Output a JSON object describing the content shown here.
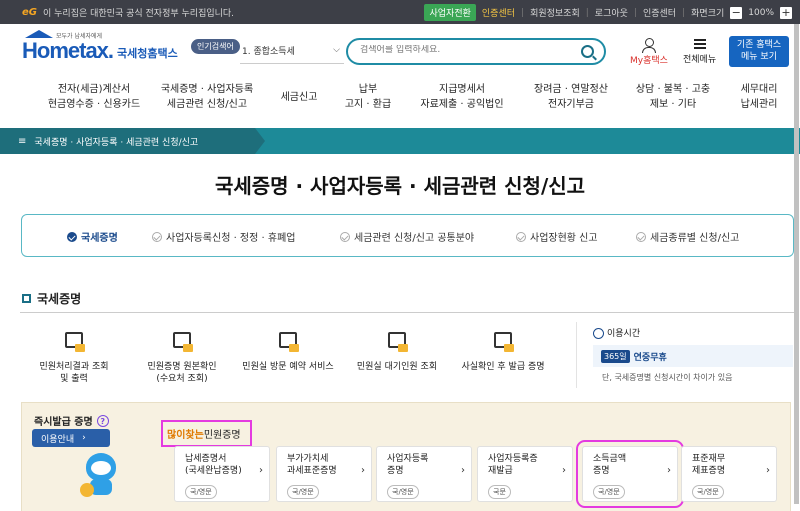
{
  "gov_bar": {
    "logo": "eG",
    "notice": "이 누리집은 대한민국 공식 전자정부 누리집입니다.",
    "items": [
      "사업자전환",
      "인증센터",
      "회원정보조회",
      "로그아웃",
      "인증센터",
      "화면크기"
    ],
    "zoom": "100%"
  },
  "header": {
    "logo_text": "Hometax.",
    "logo_name": "국세청홈택스",
    "logo_tag": "모두가 납세자에게",
    "popular_label": "인기검색어",
    "search_select": "1. 종합소득세",
    "search_placeholder": "검색어를 입력하세요.",
    "my_tax": "My홈택스",
    "all_menu": "전체메뉴",
    "basic_btn_line1": "기존 홈택스",
    "basic_btn_line2": "메뉴 보기"
  },
  "gnb": [
    {
      "l1": "전자(세금)계산서",
      "l2": "현금영수증 · 신용카드"
    },
    {
      "l1": "국세증명 · 사업자등록",
      "l2": "세금관련 신청/신고"
    },
    {
      "l1": "세금신고",
      "l2": ""
    },
    {
      "l1": "납부",
      "l2": "고지 · 환급"
    },
    {
      "l1": "지급명세서",
      "l2": "자료제출 · 공익법인"
    },
    {
      "l1": "장려금 · 연말정산",
      "l2": "전자기부금"
    },
    {
      "l1": "상담 · 불복 · 고충",
      "l2": "제보 · 기타"
    },
    {
      "l1": "세무대리",
      "l2": "납세관리"
    }
  ],
  "breadcrumb": "국세증명 · 사업자등록 · 세금관련 신청/신고",
  "page_title": "국세증명 · 사업자등록 · 세금관련 신청/신고",
  "tabs": [
    "국세증명",
    "사업자등록신청 · 정정 · 휴폐업",
    "세금관련 신청/신고 공통분야",
    "사업장현황 신고",
    "세금종류별 신청/신고"
  ],
  "section_title": "국세증명",
  "services": [
    {
      "l1": "민원처리결과 조회",
      "l2": "및 출력"
    },
    {
      "l1": "민원증명 원본확인",
      "l2": "(수요처 조회)"
    },
    {
      "l1": "민원실 방문 예약 서비스",
      "l2": ""
    },
    {
      "l1": "민원실 대기인원 조회",
      "l2": ""
    },
    {
      "l1": "사실확인 후 발급 증명",
      "l2": ""
    }
  ],
  "use_time": {
    "title": "이용시간",
    "badge": "365일",
    "value": "연중무휴",
    "note": "단, 국세증명별 신청시간이 차이가 있음"
  },
  "instant": {
    "title": "즉시발급 증명",
    "help": "?",
    "guide_btn": "이용안내",
    "popular_hot": "많이찾는",
    "popular_rest": " 민원증명",
    "cards": [
      {
        "l1": "납세증명서",
        "l2": "(국세완납증명)",
        "chip": "국/영문"
      },
      {
        "l1": "부가가치세",
        "l2": "과세표준증명",
        "chip": "국/영문"
      },
      {
        "l1": "사업자등록",
        "l2": "증명",
        "chip": "국/영문"
      },
      {
        "l1": "사업자등록증",
        "l2": "재발급",
        "chip": "국문"
      },
      {
        "l1": "소득금액",
        "l2": "증명",
        "chip": "국/영문"
      },
      {
        "l1": "표준재무",
        "l2": "제표증명",
        "chip": "국/영문"
      }
    ]
  }
}
